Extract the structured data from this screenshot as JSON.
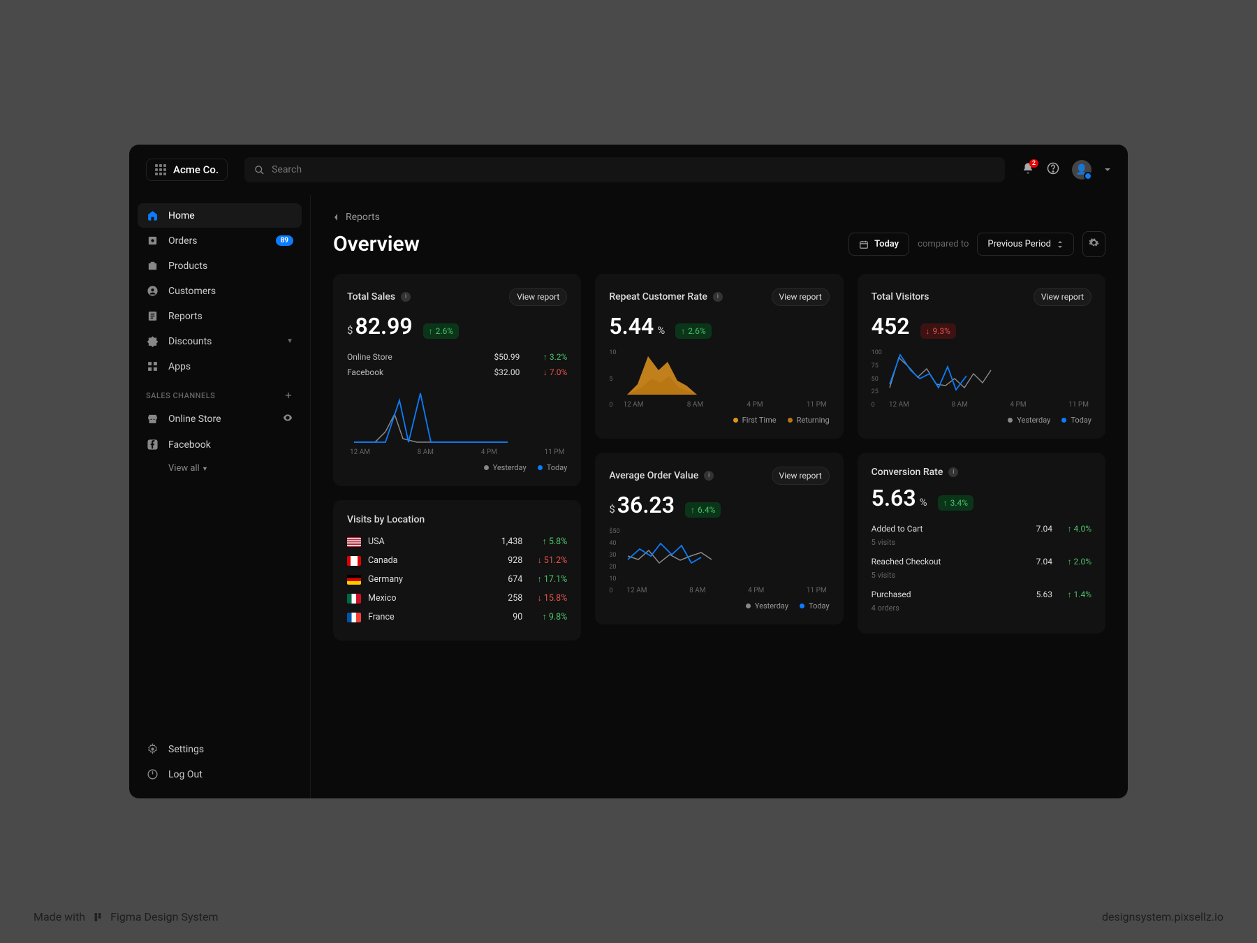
{
  "brand": "Acme Co.",
  "search": {
    "placeholder": "Search"
  },
  "notifications": {
    "count": 2
  },
  "sidebar": {
    "items": [
      {
        "label": "Home",
        "icon": "home",
        "active": true
      },
      {
        "label": "Orders",
        "icon": "orders",
        "badge": "89"
      },
      {
        "label": "Products",
        "icon": "products"
      },
      {
        "label": "Customers",
        "icon": "customers"
      },
      {
        "label": "Reports",
        "icon": "reports"
      },
      {
        "label": "Discounts",
        "icon": "discounts",
        "caret": true
      },
      {
        "label": "Apps",
        "icon": "apps"
      }
    ],
    "channels_label": "SALES CHANNELS",
    "channels": [
      {
        "label": "Online Store",
        "icon": "store",
        "eye": true
      },
      {
        "label": "Facebook",
        "icon": "facebook"
      }
    ],
    "view_all": "View all",
    "bottom": [
      {
        "label": "Settings",
        "icon": "gear"
      },
      {
        "label": "Log Out",
        "icon": "power"
      }
    ]
  },
  "breadcrumb": "Reports",
  "page_title": "Overview",
  "date_picker": {
    "label": "Today"
  },
  "compared_to": "compared to",
  "period_select": "Previous Period",
  "cards": {
    "total_sales": {
      "title": "Total Sales",
      "view": "View report",
      "prefix": "$",
      "value": "82.99",
      "delta": {
        "dir": "up",
        "text": "2.6%"
      },
      "rows": [
        {
          "label": "Online Store",
          "value": "$50.99",
          "dir": "up",
          "change": "3.2%"
        },
        {
          "label": "Facebook",
          "value": "$32.00",
          "dir": "down",
          "change": "7.0%"
        }
      ],
      "x_ticks": [
        "12 AM",
        "8 AM",
        "4 PM",
        "11 PM"
      ],
      "legend": [
        "Yesterday",
        "Today"
      ]
    },
    "repeat": {
      "title": "Repeat Customer Rate",
      "view": "View report",
      "value": "5.44",
      "suffix": "%",
      "delta": {
        "dir": "up",
        "text": "2.6%"
      },
      "y_ticks": [
        "10",
        "5",
        "0"
      ],
      "x_ticks": [
        "12 AM",
        "8 AM",
        "4 PM",
        "11 PM"
      ],
      "legend": [
        "First Time",
        "Returning"
      ]
    },
    "visitors": {
      "title": "Total Visitors",
      "view": "View report",
      "value": "452",
      "delta": {
        "dir": "down",
        "text": "9.3%"
      },
      "y_ticks": [
        "100",
        "75",
        "50",
        "25",
        "0"
      ],
      "x_ticks": [
        "12 AM",
        "8 AM",
        "4 PM",
        "11 PM"
      ],
      "legend": [
        "Yesterday",
        "Today"
      ]
    },
    "visits_loc": {
      "title": "Visits by Location",
      "rows": [
        {
          "flag": "us",
          "label": "USA",
          "value": "1,438",
          "dir": "up",
          "change": "5.8%"
        },
        {
          "flag": "ca",
          "label": "Canada",
          "value": "928",
          "dir": "down",
          "change": "51.2%"
        },
        {
          "flag": "de",
          "label": "Germany",
          "value": "674",
          "dir": "up",
          "change": "17.1%"
        },
        {
          "flag": "mx",
          "label": "Mexico",
          "value": "258",
          "dir": "down",
          "change": "15.8%"
        },
        {
          "flag": "fr",
          "label": "France",
          "value": "90",
          "dir": "up",
          "change": "9.8%"
        }
      ]
    },
    "aov": {
      "title": "Average Order Value",
      "view": "View report",
      "prefix": "$",
      "value": "36.23",
      "delta": {
        "dir": "up",
        "text": "6.4%"
      },
      "y_ticks": [
        "$50",
        "40",
        "30",
        "20",
        "10",
        "0"
      ],
      "x_ticks": [
        "12 AM",
        "8 AM",
        "4 PM",
        "11 PM"
      ],
      "legend": [
        "Yesterday",
        "Today"
      ]
    },
    "conversion": {
      "title": "Conversion Rate",
      "value": "5.63",
      "suffix": "%",
      "delta": {
        "dir": "up",
        "text": "3.4%"
      },
      "rows": [
        {
          "label": "Added to Cart",
          "meta": "5 visits",
          "value": "7.04",
          "dir": "up",
          "change": "4.0%"
        },
        {
          "label": "Reached Checkout",
          "meta": "5 visits",
          "value": "7.04",
          "dir": "up",
          "change": "2.0%"
        },
        {
          "label": "Purchased",
          "meta": "4 orders",
          "value": "5.63",
          "dir": "up",
          "change": "1.4%"
        }
      ]
    }
  },
  "footer": {
    "left": "Made with",
    "mid": "Figma Design System",
    "right": "designsystem.pixsellz.io"
  },
  "colors": {
    "accent": "#0b7cff",
    "green": "#4ac26b",
    "red": "#e5534b",
    "orange": "#e0941f",
    "gray": "#888"
  },
  "chart_data": [
    {
      "type": "line",
      "title": "Total Sales",
      "x_ticks": [
        "12 AM",
        "8 AM",
        "4 PM",
        "11 PM"
      ],
      "series": [
        {
          "name": "Yesterday",
          "color": "#888",
          "values": [
            0,
            0,
            8,
            25,
            5,
            0,
            0,
            0,
            0,
            0,
            0,
            0
          ]
        },
        {
          "name": "Today",
          "color": "#0b7cff",
          "values": [
            0,
            0,
            0,
            70,
            0,
            85,
            0,
            0,
            0,
            0,
            0,
            0
          ]
        }
      ]
    },
    {
      "type": "area",
      "title": "Repeat Customer Rate",
      "x_ticks": [
        "12 AM",
        "8 AM",
        "4 PM",
        "11 PM"
      ],
      "ylim": [
        0,
        10
      ],
      "series": [
        {
          "name": "First Time",
          "color": "#e0941f",
          "values": [
            0,
            2,
            9,
            6,
            8,
            4,
            3,
            0,
            0,
            0,
            0,
            0
          ]
        },
        {
          "name": "Returning",
          "color": "#b87514",
          "values": [
            0,
            1,
            4,
            3,
            5,
            2,
            1,
            0,
            0,
            0,
            0,
            0
          ]
        }
      ]
    },
    {
      "type": "line",
      "title": "Total Visitors",
      "x_ticks": [
        "12 AM",
        "8 AM",
        "4 PM",
        "11 PM"
      ],
      "ylim": [
        0,
        100
      ],
      "series": [
        {
          "name": "Yesterday",
          "color": "#888",
          "values": [
            20,
            75,
            60,
            40,
            55,
            30,
            25,
            35,
            20,
            45,
            30,
            50
          ]
        },
        {
          "name": "Today",
          "color": "#0b7cff",
          "values": [
            25,
            80,
            50,
            35,
            45,
            20,
            50,
            15,
            40,
            null,
            null,
            null
          ]
        }
      ]
    },
    {
      "type": "line",
      "title": "Average Order Value",
      "x_ticks": [
        "12 AM",
        "8 AM",
        "4 PM",
        "11 PM"
      ],
      "ylim": [
        0,
        50
      ],
      "series": [
        {
          "name": "Yesterday",
          "color": "#888",
          "values": [
            30,
            28,
            35,
            25,
            32,
            27,
            30,
            33,
            28,
            null,
            null,
            null
          ]
        },
        {
          "name": "Today",
          "color": "#0b7cff",
          "values": [
            28,
            35,
            30,
            40,
            32,
            38,
            25,
            30,
            null,
            null,
            null,
            null
          ]
        }
      ]
    }
  ],
  "flags": {
    "us": "linear-gradient(#b22234 0 11%,#fff 11% 22%,#b22234 22% 33%,#fff 33% 44%,#b22234 44% 55%,#fff 55% 66%,#b22234 66% 77%,#fff 77% 88%,#b22234 88% 100%)",
    "ca": "linear-gradient(90deg,#d00 0 25%,#fff 25% 75%,#d00 75% 100%)",
    "de": "linear-gradient(#000 0 33%,#d00 33% 66%,#fc0 66% 100%)",
    "mx": "linear-gradient(90deg,#006847 0 33%,#fff 33% 66%,#ce1126 66% 100%)",
    "fr": "linear-gradient(90deg,#0055a4 0 33%,#fff 33% 66%,#ef4135 66% 100%)"
  }
}
